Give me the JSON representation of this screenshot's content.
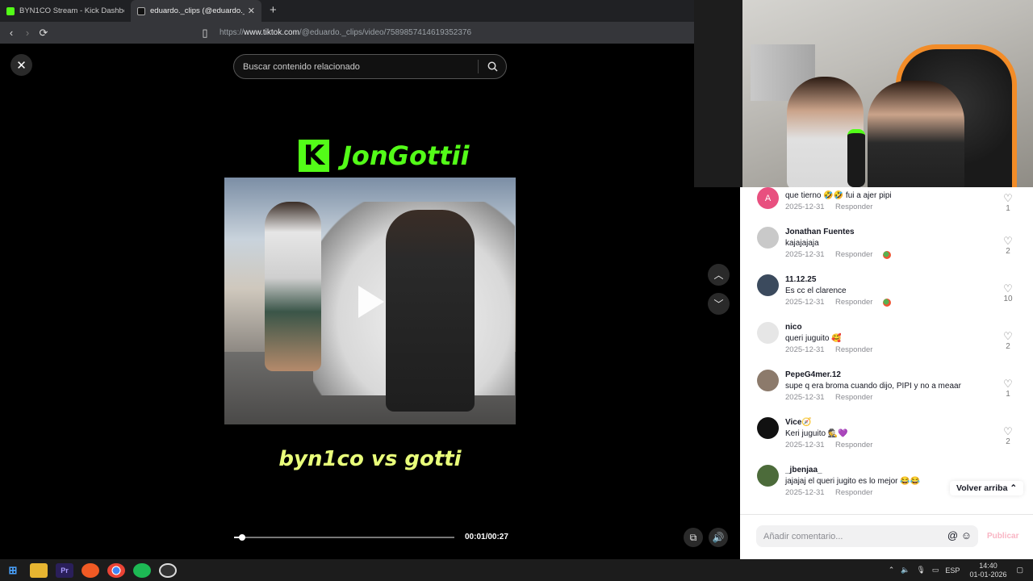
{
  "browser": {
    "tabs": [
      {
        "title": "BYN1CO Stream - Kick Dashboard",
        "active": false
      },
      {
        "title": "eduardo._clips (@eduardo._clips)",
        "active": true
      }
    ],
    "url_prefix": "https://",
    "url_domain": "www.tiktok.com",
    "url_path": "/@eduardo._clips/video/7589857414619352376"
  },
  "player": {
    "search_placeholder": "Buscar contenido relacionado",
    "kick_logo_letter": "K",
    "title_text": "JonGottii",
    "caption": "byn1co vs gotti",
    "time": "00:01/00:27",
    "progress_fraction": 0.037
  },
  "comments": [
    {
      "user": "",
      "text": "que tierno 🤣🤣 fui a ajer pipi",
      "date": "2025-12-31",
      "reply": "Responder",
      "likes": "1",
      "avatar_letter": "A",
      "avatar_color": "#e8507f"
    },
    {
      "user": "Jonathan Fuentes",
      "text": "kajajajaja",
      "date": "2025-12-31",
      "reply": "Responder",
      "likes": "2",
      "avatar_letter": "",
      "avatar_color": "#c9c9c9",
      "badge": true
    },
    {
      "user": "11.12.25",
      "text": "Es cc el clarence",
      "date": "2025-12-31",
      "reply": "Responder",
      "likes": "10",
      "avatar_letter": "",
      "avatar_color": "#3b4a5d",
      "badge": true
    },
    {
      "user": "nico",
      "text": "queri juguito 🥰",
      "date": "2025-12-31",
      "reply": "Responder",
      "likes": "2",
      "avatar_letter": "",
      "avatar_color": "#e6e6e6"
    },
    {
      "user": "PepeG4mer.12",
      "text": "supe q era broma cuando dijo, PIPI y no a meaar",
      "date": "2025-12-31",
      "reply": "Responder",
      "likes": "1",
      "avatar_letter": "",
      "avatar_color": "#8c7a6b"
    },
    {
      "user": "Vice🧭",
      "text": "Keri juguito 🕵️💜",
      "date": "2025-12-31",
      "reply": "Responder",
      "likes": "2",
      "avatar_letter": "",
      "avatar_color": "#111111"
    },
    {
      "user": "_jbenjaa_",
      "text": "jajajaj el queri jugito es lo mejor 😂😂",
      "date": "2025-12-31",
      "reply": "Responder",
      "likes": "",
      "avatar_letter": "",
      "avatar_color": "#4c6b3a"
    }
  ],
  "volver": "Volver arriba",
  "comment_input_placeholder": "Añadir comentario...",
  "publicar": "Publicar",
  "taskbar": {
    "lang": "ESP",
    "time": "14:40",
    "date": "01-01-2026"
  }
}
